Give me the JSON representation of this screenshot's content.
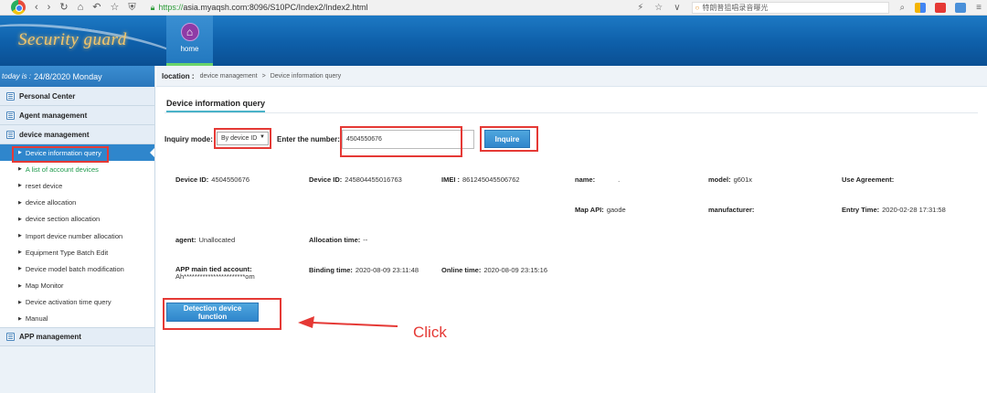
{
  "browser": {
    "url_proto": "https://",
    "url_rest": "asia.myaqsh.com:8096/S10PC/Index2/Index2.html",
    "search_text": "特朗普狙唱录音曝光"
  },
  "header": {
    "brand": "Security guard",
    "home_label": "home"
  },
  "sidebar": {
    "date_prefix": "today is :",
    "date_value": "24/8/2020 Monday",
    "personal_center": "Personal Center",
    "agent_management": "Agent management",
    "device_management": "device management",
    "items": [
      "Device information query",
      "A list of account devices",
      "reset device",
      "device allocation",
      "device section allocation",
      "Import device number allocation",
      "Equipment Type Batch Edit",
      "Device model batch modification",
      "Map Monitor",
      "Device activation time query",
      "Manual"
    ],
    "app_management": "APP management"
  },
  "breadcrumb": {
    "label": "location :",
    "crumb1": "device management",
    "sep": ">",
    "crumb2": "Device information query"
  },
  "page": {
    "title": "Device information query",
    "inquiry_mode_label": "Inquiry mode:",
    "inquiry_mode_value": "By device ID",
    "enter_number_label": "Enter the number:",
    "number_value": "4504550676",
    "inquire_button": "Inquire"
  },
  "device_info": {
    "device_id_1_label": "Device ID:",
    "device_id_1_value": "4504550676",
    "device_id_2_label": "Device ID:",
    "device_id_2_value": "245804455016763",
    "imei_label": "IMEI :",
    "imei_value": "861245045506762",
    "name_label": "name:",
    "name_value": ".",
    "model_label": "model:",
    "model_value": "g601x",
    "use_agreement_label": "Use Agreement:",
    "map_api_label": "Map API:",
    "map_api_value": "gaode",
    "manufacturer_label": "manufacturer:",
    "entry_time_label": "Entry Time:",
    "entry_time_value": "2020-02-28 17:31:58",
    "agent_label": "agent:",
    "agent_value": "Unallocated",
    "allocation_time_label": "Allocation time:",
    "allocation_time_value": "--",
    "app_account_label": "APP main tied account:",
    "app_account_value": "Ah***********************om",
    "binding_time_label": "Binding time:",
    "binding_time_value": "2020-08-09 23:11:48",
    "online_time_label": "Online time:",
    "online_time_value": "2020-08-09 23:15:16"
  },
  "actions": {
    "detection_button": "Detection device function",
    "click_note": "Click"
  },
  "colors": {
    "highlight": "#e53935",
    "accent_blue": "#2f86cc"
  }
}
